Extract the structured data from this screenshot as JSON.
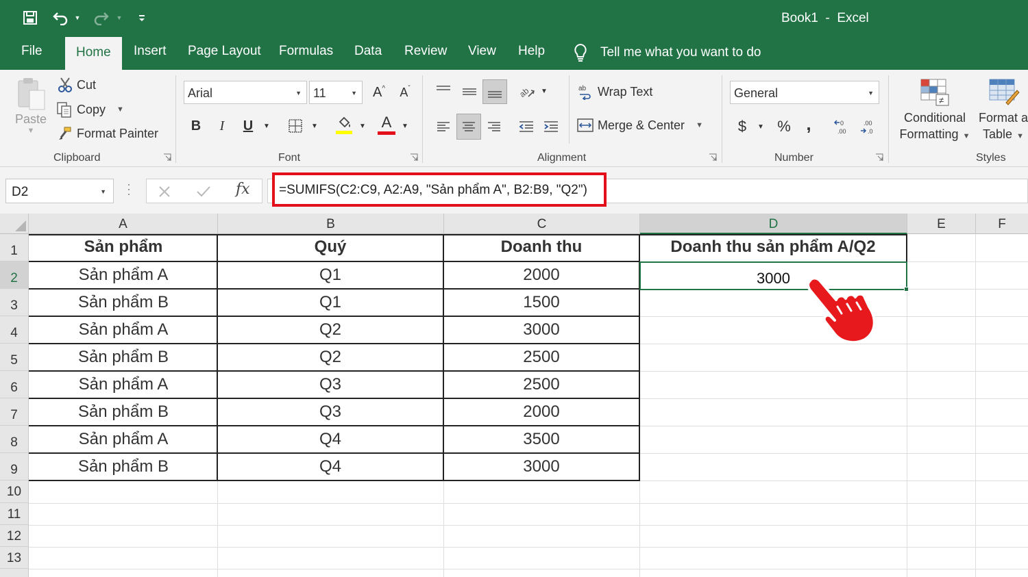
{
  "window": {
    "title": "Book1  -  Excel"
  },
  "quick_access": {
    "icons": [
      "save-icon",
      "undo-icon",
      "redo-icon",
      "customize-qat-icon"
    ]
  },
  "menu": {
    "tabs": [
      "File",
      "Home",
      "Insert",
      "Page Layout",
      "Formulas",
      "Data",
      "Review",
      "View",
      "Help"
    ],
    "active_tab": "Home",
    "tell_me": "Tell me what you want to do"
  },
  "ribbon": {
    "clipboard": {
      "label": "Clipboard",
      "paste": "Paste",
      "cut": "Cut",
      "copy": "Copy",
      "format_painter": "Format Painter"
    },
    "font": {
      "label": "Font",
      "font_name": "Arial",
      "font_size": "11",
      "bold": "B",
      "italic": "I",
      "underline": "U",
      "increase_size": "A",
      "decrease_size": "A",
      "font_color_letter": "A",
      "highlight_color": "#ffff00",
      "font_color": "#e3101c"
    },
    "alignment": {
      "label": "Alignment",
      "wrap_text": "Wrap Text",
      "merge_center": "Merge & Center"
    },
    "number": {
      "label": "Number",
      "format": "General",
      "currency": "$",
      "percent": "%",
      "comma": ","
    },
    "styles": {
      "label": "Styles",
      "conditional_formatting_line1": "Conditional",
      "conditional_formatting_line2": "Formatting",
      "format_table_line1": "Format a",
      "format_table_line2": "Table"
    }
  },
  "formula_bar": {
    "name_box": "D2",
    "fx": "fx",
    "formula": "=SUMIFS(C2:C9, A2:A9, \"Sản phẩm A\", B2:B9, \"Q2\")"
  },
  "grid": {
    "columns": [
      "A",
      "B",
      "C",
      "D",
      "E",
      "F"
    ],
    "selected_column": "D",
    "rows": [
      "1",
      "2",
      "3",
      "4",
      "5",
      "6",
      "7",
      "8",
      "9",
      "10",
      "11",
      "12",
      "13"
    ],
    "selected_row": "2",
    "headers": [
      "Sản phẩm",
      "Quý",
      "Doanh thu",
      "Doanh thu sản phẩm A/Q2"
    ],
    "data": [
      [
        "Sản phẩm A",
        "Q1",
        "2000"
      ],
      [
        "Sản phẩm B",
        "Q1",
        "1500"
      ],
      [
        "Sản phẩm A",
        "Q2",
        "3000"
      ],
      [
        "Sản phẩm B",
        "Q2",
        "2500"
      ],
      [
        "Sản phẩm A",
        "Q3",
        "2500"
      ],
      [
        "Sản phẩm B",
        "Q3",
        "2000"
      ],
      [
        "Sản phẩm A",
        "Q4",
        "3500"
      ],
      [
        "Sản phẩm B",
        "Q4",
        "3000"
      ]
    ],
    "result": "3000"
  },
  "colors": {
    "excel_green": "#217346",
    "highlight_red": "#e3101c",
    "pointer_red": "#e8191c"
  }
}
